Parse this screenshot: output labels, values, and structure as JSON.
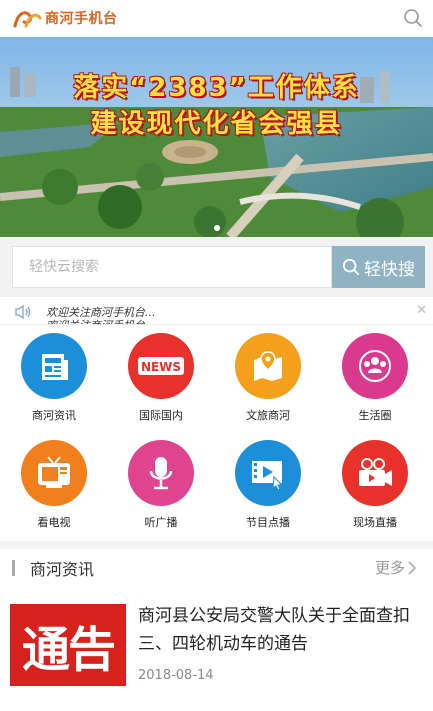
{
  "header": {
    "app_name": "商河手机台",
    "brand_color": "#d9641c"
  },
  "banner": {
    "headline_line1": "落实“2383”工作体系",
    "headline_line2": "建设现代化省会强县",
    "headline_color": "#ffe040",
    "outline_color": "#b4141c"
  },
  "search": {
    "placeholder": "轻快云搜索",
    "button_label": "轻快搜",
    "button_color": "#8fb3c3"
  },
  "notice": {
    "text": "欢迎关注商河手机台..."
  },
  "menu": [
    {
      "label": "商河资讯",
      "icon": "newspaper-icon",
      "color": "#1d8fd8"
    },
    {
      "label": "国际国内",
      "icon": "news-badge-icon",
      "color": "#e8312a"
    },
    {
      "label": "文旅商河",
      "icon": "map-pin-icon",
      "color": "#f4a01d"
    },
    {
      "label": "生活圈",
      "icon": "people-circle-icon",
      "color": "#d93a8e"
    },
    {
      "label": "看电视",
      "icon": "tv-icon",
      "color": "#f07f1d"
    },
    {
      "label": "听广播",
      "icon": "microphone-icon",
      "color": "#e0448e"
    },
    {
      "label": "节目点播",
      "icon": "video-play-icon",
      "color": "#1d8fd8"
    },
    {
      "label": "现场直播",
      "icon": "video-camera-icon",
      "color": "#e8312a"
    }
  ],
  "section": {
    "title": "商河资讯",
    "more_label": "更多"
  },
  "news": [
    {
      "thumb_text": "通告",
      "title": "商河县公安局交警大队关于全面查扣三、四轮机动车的通告",
      "date": "2018-08-14"
    }
  ]
}
